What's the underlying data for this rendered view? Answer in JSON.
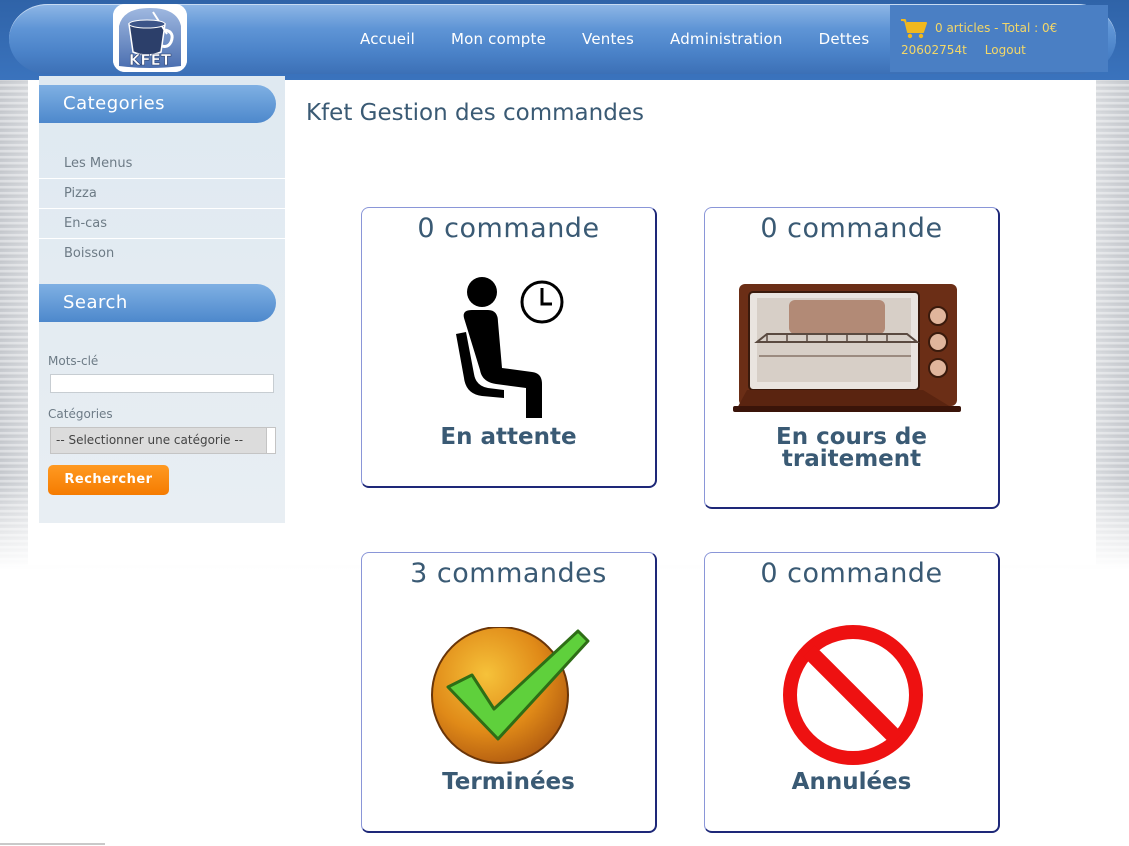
{
  "header": {
    "logo_text": "KFET",
    "nav": [
      "Accueil",
      "Mon compte",
      "Ventes",
      "Administration",
      "Dettes"
    ],
    "cart": {
      "summary": "0 articles - Total : 0€",
      "user": "20602754t",
      "logout": "Logout"
    }
  },
  "sidebar": {
    "categories_title": "Categories",
    "categories": [
      "Les Menus",
      "Pizza",
      "En-cas",
      "Boisson"
    ],
    "search_title": "Search",
    "keywords_label": "Mots-clé",
    "keywords_value": "",
    "category_label": "Catégories",
    "category_select": "-- Selectionner une catégorie --",
    "search_button": "Rechercher"
  },
  "main": {
    "title": "Kfet Gestion des commandes",
    "cards": [
      {
        "count": "0 commande",
        "label": "En attente",
        "icon": "waiting-person-icon"
      },
      {
        "count": "0 commande",
        "label": "En cours de traitement",
        "icon": "oven-icon"
      },
      {
        "count": "3 commandes",
        "label": "Terminées",
        "icon": "checkmark-icon"
      },
      {
        "count": "0 commande",
        "label": "Annulées",
        "icon": "prohibited-icon"
      }
    ]
  },
  "colors": {
    "header_blue": "#4a82c8",
    "title_text": "#3a5a74",
    "cart_text": "#f3d768",
    "button_orange": "#f57b00",
    "card_border": "#1e2878"
  }
}
